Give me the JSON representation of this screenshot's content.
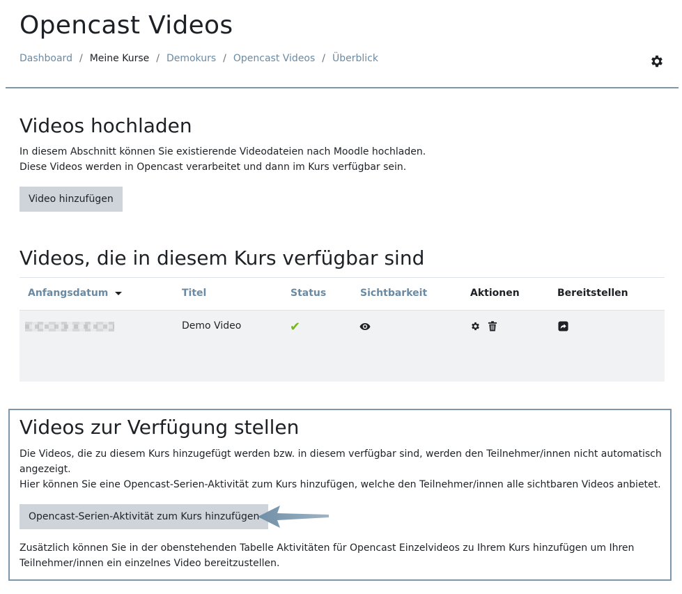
{
  "header": {
    "title": "Opencast Videos",
    "breadcrumb": [
      {
        "label": "Dashboard",
        "link": true
      },
      {
        "label": "Meine Kurse",
        "link": false
      },
      {
        "label": "Demokurs",
        "link": true
      },
      {
        "label": "Opencast Videos",
        "link": true
      },
      {
        "label": "Überblick",
        "link": true
      }
    ],
    "separator": "/"
  },
  "upload": {
    "title": "Videos hochladen",
    "line1": "In diesem Abschnitt können Sie existierende Videodateien nach Moodle hochladen.",
    "line2": "Diese Videos werden in Opencast verarbeitet und dann im Kurs verfügbar sein.",
    "button": "Video hinzufügen"
  },
  "videos": {
    "title": "Videos, die in diesem Kurs verfügbar sind",
    "columns": {
      "date": "Anfangsdatum",
      "title": "Titel",
      "status": "Status",
      "visibility": "Sichtbarkeit",
      "actions": "Aktionen",
      "provide": "Bereitstellen"
    },
    "rows": [
      {
        "title": "Demo Video",
        "status": "✔"
      }
    ]
  },
  "provide": {
    "title": "Videos zur Verfügung stellen",
    "line1": "Die Videos, die zu diesem Kurs hinzugefügt werden bzw. in diesem verfügbar sind, werden den Teilnehmer/innen nicht automatisch",
    "line2": "angezeigt.",
    "line3": "Hier können Sie eine Opencast-Serien-Aktivität zum Kurs hinzufügen, welche den Teilnehmer/innen alle sichtbaren Videos anbietet.",
    "button": "Opencast-Serien-Aktivität zum Kurs hinzufügen",
    "line4": "Zusätzlich können Sie in der obenstehenden Tabelle Aktivitäten für Opencast Einzelvideos zu Ihrem Kurs hinzufügen um Ihren",
    "line5": "Teilnehmer/innen ein einzelnes Video bereitzustellen."
  },
  "colors": {
    "link": "#6a8aa3",
    "accent_border": "#7d97a8",
    "button_bg": "#ced4da",
    "status_ok": "#7ab51d"
  },
  "icons": {
    "settings": "gear-icon",
    "sort": "caret-down-icon",
    "visibility": "eye-icon",
    "edit": "gear-icon",
    "delete": "trash-icon",
    "share": "share-icon"
  }
}
